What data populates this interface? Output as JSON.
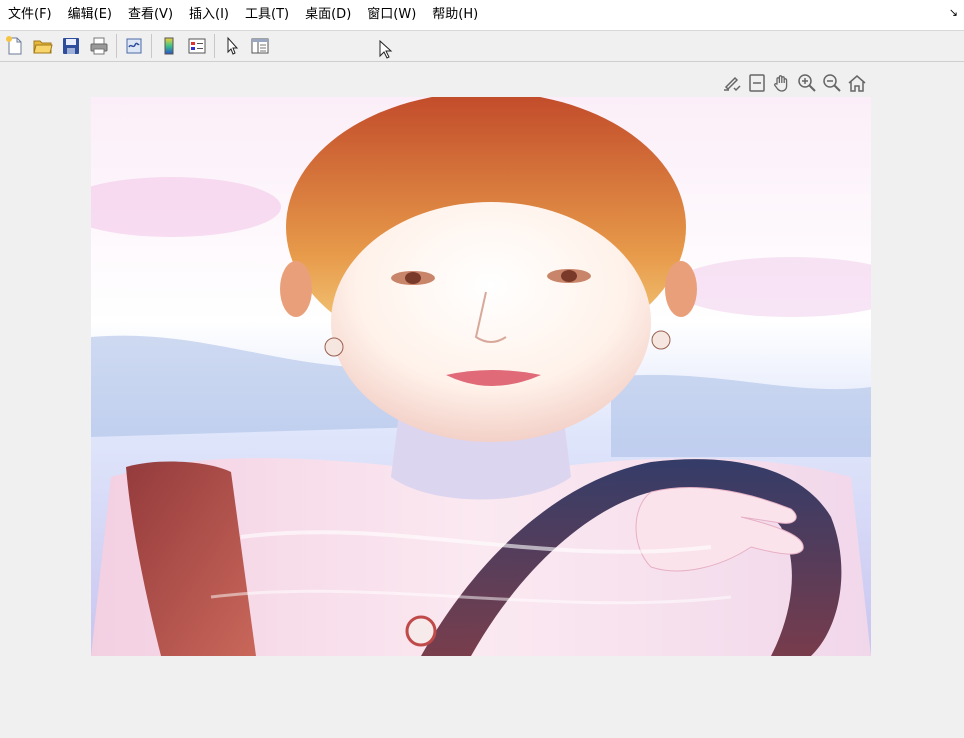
{
  "menubar": {
    "items": [
      {
        "label": "文件(F)"
      },
      {
        "label": "编辑(E)"
      },
      {
        "label": "查看(V)"
      },
      {
        "label": "插入(I)"
      },
      {
        "label": "工具(T)"
      },
      {
        "label": "桌面(D)"
      },
      {
        "label": "窗口(W)"
      },
      {
        "label": "帮助(H)"
      }
    ],
    "dock_arrow": "↘"
  },
  "toolbar": {
    "icons": [
      "new-figure-icon",
      "open-file-icon",
      "save-icon",
      "print-icon",
      "link-plot-icon",
      "colorbar-icon",
      "legend-icon",
      "edit-plot-cursor-icon",
      "property-inspector-icon"
    ]
  },
  "axes_toolbar": {
    "icons": [
      "brush-icon",
      "data-tips-icon",
      "pan-icon",
      "zoom-in-icon",
      "zoom-out-icon",
      "home-icon"
    ]
  },
  "colors": {
    "menubar_bg": "#ffffff",
    "window_bg": "#f0f0f0",
    "hair": "#c9623a",
    "sky_pink": "#f2c6e6",
    "sea_blue": "#9fb2e0"
  }
}
